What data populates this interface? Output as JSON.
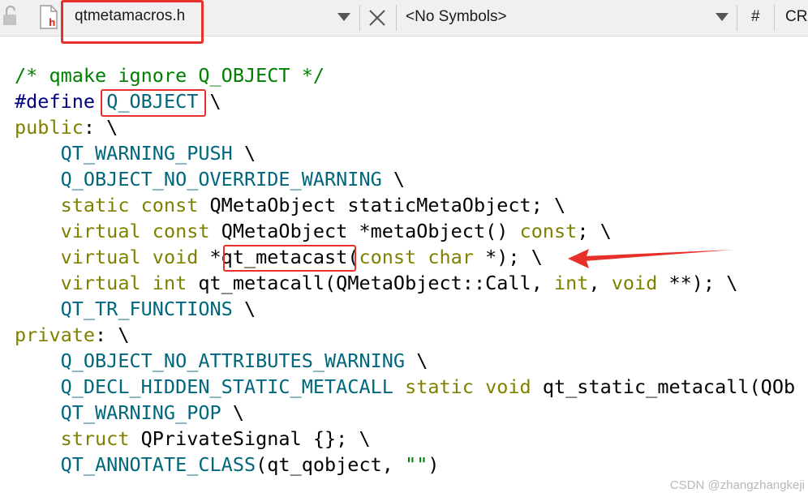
{
  "toolbar": {
    "file_name": "qtmetamacros.h",
    "symbols": "<No Symbols>",
    "hash": "#",
    "cr": "CR"
  },
  "code_lines": [
    [
      {
        "t": "/* qmake ignore Q_OBJECT */",
        "c": "cm"
      }
    ],
    [
      {
        "t": "#define",
        "c": "pp"
      },
      {
        "t": " ",
        "c": "tx"
      },
      {
        "t": "Q_OBJECT",
        "c": "mc"
      },
      {
        "t": " \\",
        "c": "tx"
      }
    ],
    [
      {
        "t": "public",
        "c": "kw"
      },
      {
        "t": ": \\",
        "c": "tx"
      }
    ],
    [
      {
        "t": "    ",
        "c": "tx"
      },
      {
        "t": "QT_WARNING_PUSH",
        "c": "mc"
      },
      {
        "t": " \\",
        "c": "tx"
      }
    ],
    [
      {
        "t": "    ",
        "c": "tx"
      },
      {
        "t": "Q_OBJECT_NO_OVERRIDE_WARNING",
        "c": "mc"
      },
      {
        "t": " \\",
        "c": "tx"
      }
    ],
    [
      {
        "t": "    ",
        "c": "tx"
      },
      {
        "t": "static",
        "c": "kw"
      },
      {
        "t": " ",
        "c": "tx"
      },
      {
        "t": "const",
        "c": "kw"
      },
      {
        "t": " QMetaObject staticMetaObject; \\",
        "c": "tx"
      }
    ],
    [
      {
        "t": "    ",
        "c": "tx"
      },
      {
        "t": "virtual",
        "c": "kw"
      },
      {
        "t": " ",
        "c": "tx"
      },
      {
        "t": "const",
        "c": "kw"
      },
      {
        "t": " QMetaObject *metaObject() ",
        "c": "tx"
      },
      {
        "t": "const",
        "c": "kw"
      },
      {
        "t": "; \\",
        "c": "tx"
      }
    ],
    [
      {
        "t": "    ",
        "c": "tx"
      },
      {
        "t": "virtual",
        "c": "kw"
      },
      {
        "t": " ",
        "c": "tx"
      },
      {
        "t": "void",
        "c": "kw"
      },
      {
        "t": " *qt_metacast(",
        "c": "tx"
      },
      {
        "t": "const",
        "c": "kw"
      },
      {
        "t": " ",
        "c": "tx"
      },
      {
        "t": "char",
        "c": "kw"
      },
      {
        "t": " *); \\",
        "c": "tx"
      }
    ],
    [
      {
        "t": "    ",
        "c": "tx"
      },
      {
        "t": "virtual",
        "c": "kw"
      },
      {
        "t": " ",
        "c": "tx"
      },
      {
        "t": "int",
        "c": "kw"
      },
      {
        "t": " qt_metacall(QMetaObject::Call, ",
        "c": "tx"
      },
      {
        "t": "int",
        "c": "kw"
      },
      {
        "t": ", ",
        "c": "tx"
      },
      {
        "t": "void",
        "c": "kw"
      },
      {
        "t": " **); \\",
        "c": "tx"
      }
    ],
    [
      {
        "t": "    ",
        "c": "tx"
      },
      {
        "t": "QT_TR_FUNCTIONS",
        "c": "mc"
      },
      {
        "t": " \\",
        "c": "tx"
      }
    ],
    [
      {
        "t": "private",
        "c": "kw"
      },
      {
        "t": ": \\",
        "c": "tx"
      }
    ],
    [
      {
        "t": "    ",
        "c": "tx"
      },
      {
        "t": "Q_OBJECT_NO_ATTRIBUTES_WARNING",
        "c": "mc"
      },
      {
        "t": " \\",
        "c": "tx"
      }
    ],
    [
      {
        "t": "    ",
        "c": "tx"
      },
      {
        "t": "Q_DECL_HIDDEN_STATIC_METACALL",
        "c": "mc"
      },
      {
        "t": " ",
        "c": "tx"
      },
      {
        "t": "static",
        "c": "kw"
      },
      {
        "t": " ",
        "c": "tx"
      },
      {
        "t": "void",
        "c": "kw"
      },
      {
        "t": " qt_static_metacall(QOb",
        "c": "tx"
      }
    ],
    [
      {
        "t": "    ",
        "c": "tx"
      },
      {
        "t": "QT_WARNING_POP",
        "c": "mc"
      },
      {
        "t": " \\",
        "c": "tx"
      }
    ],
    [
      {
        "t": "    ",
        "c": "tx"
      },
      {
        "t": "struct",
        "c": "kw"
      },
      {
        "t": " QPrivateSignal {}; \\",
        "c": "tx"
      }
    ],
    [
      {
        "t": "    ",
        "c": "tx"
      },
      {
        "t": "QT_ANNOTATE_CLASS",
        "c": "mc"
      },
      {
        "t": "(qt_qobject, ",
        "c": "tx"
      },
      {
        "t": "\"\"",
        "c": "st"
      },
      {
        "t": ")",
        "c": "tx"
      }
    ]
  ],
  "colors": {
    "comment": "#008000",
    "preprocessor": "#000080",
    "keyword": "#808000",
    "macro": "#00677c",
    "annotation": "#e8302a"
  },
  "watermark": "CSDN @zhangzhangkeji"
}
